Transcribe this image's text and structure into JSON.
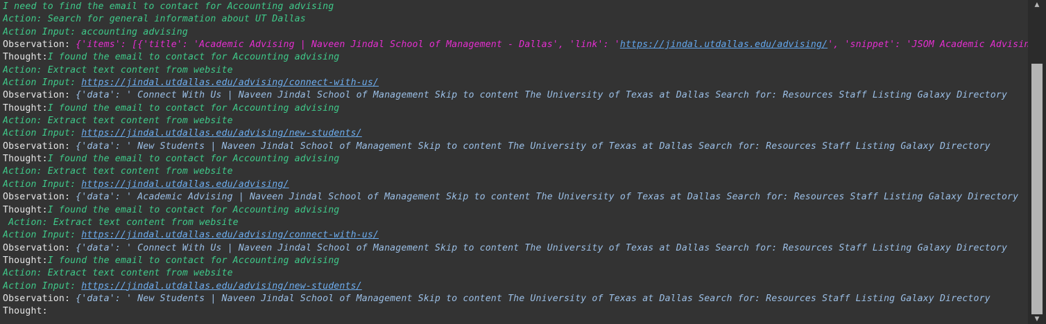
{
  "terminal": {
    "lines": [
      {
        "segments": [
          {
            "text": "I need to find the email to contact for Accounting advising",
            "style": "green"
          }
        ]
      },
      {
        "segments": [
          {
            "text": "Action: Search for general information about UT Dallas",
            "style": "green"
          }
        ]
      },
      {
        "segments": [
          {
            "text": "Action Input: accounting advising",
            "style": "green"
          }
        ]
      },
      {
        "segments": [
          {
            "text": "Observation: ",
            "style": "plain"
          },
          {
            "text": "{'items': [{'title': 'Academic Advising | Naveen Jindal School of Management - Dallas', 'link': '",
            "style": "magenta"
          },
          {
            "text": "https://jindal.utdallas.edu/advising/",
            "style": "link-mag"
          },
          {
            "text": "', 'snippet': 'JSOM Academic Advising",
            "style": "magenta"
          }
        ]
      },
      {
        "segments": [
          {
            "text": "Thought:",
            "style": "plain"
          },
          {
            "text": "I found the email to contact for Accounting advising",
            "style": "green"
          }
        ]
      },
      {
        "segments": [
          {
            "text": "Action: Extract text content from website",
            "style": "green"
          }
        ]
      },
      {
        "segments": [
          {
            "text": "Action Input: ",
            "style": "green"
          },
          {
            "text": "https://jindal.utdallas.edu/advising/connect-with-us/",
            "style": "link"
          }
        ]
      },
      {
        "segments": [
          {
            "text": "Observation: ",
            "style": "plain"
          },
          {
            "text": "{'data': ' Connect With Us | Naveen Jindal School of Management Skip to content The University of Texas at Dallas Search for: Resources Staff Listing Galaxy Directory",
            "style": "blue"
          }
        ]
      },
      {
        "segments": [
          {
            "text": "Thought:",
            "style": "plain"
          },
          {
            "text": "I found the email to contact for Accounting advising",
            "style": "green"
          }
        ]
      },
      {
        "segments": [
          {
            "text": "Action: Extract text content from website",
            "style": "green"
          }
        ]
      },
      {
        "segments": [
          {
            "text": "Action Input: ",
            "style": "green"
          },
          {
            "text": "https://jindal.utdallas.edu/advising/new-students/",
            "style": "link"
          }
        ]
      },
      {
        "segments": [
          {
            "text": "Observation: ",
            "style": "plain"
          },
          {
            "text": "{'data': ' New Students | Naveen Jindal School of Management Skip to content The University of Texas at Dallas Search for: Resources Staff Listing Galaxy Directory",
            "style": "blue"
          }
        ]
      },
      {
        "segments": [
          {
            "text": "Thought:",
            "style": "plain"
          },
          {
            "text": "I found the email to contact for Accounting advising",
            "style": "green"
          }
        ]
      },
      {
        "segments": [
          {
            "text": "Action: Extract text content from website",
            "style": "green"
          }
        ]
      },
      {
        "segments": [
          {
            "text": "Action Input: ",
            "style": "green"
          },
          {
            "text": "https://jindal.utdallas.edu/advising/",
            "style": "link"
          }
        ]
      },
      {
        "segments": [
          {
            "text": "Observation: ",
            "style": "plain"
          },
          {
            "text": "{'data': ' Academic Advising | Naveen Jindal School of Management Skip to content The University of Texas at Dallas Search for: Resources Staff Listing Galaxy Directory",
            "style": "blue"
          }
        ]
      },
      {
        "segments": [
          {
            "text": "Thought:",
            "style": "plain"
          },
          {
            "text": "I found the email to contact for Accounting advising",
            "style": "green"
          }
        ]
      },
      {
        "segments": [
          {
            "text": " Action: Extract text content from website",
            "style": "green"
          }
        ]
      },
      {
        "segments": [
          {
            "text": "Action Input: ",
            "style": "green"
          },
          {
            "text": "https://jindal.utdallas.edu/advising/connect-with-us/",
            "style": "link"
          }
        ]
      },
      {
        "segments": [
          {
            "text": "Observation: ",
            "style": "plain"
          },
          {
            "text": "{'data': ' Connect With Us | Naveen Jindal School of Management Skip to content The University of Texas at Dallas Search for: Resources Staff Listing Galaxy Directory",
            "style": "blue"
          }
        ]
      },
      {
        "segments": [
          {
            "text": "Thought:",
            "style": "plain"
          },
          {
            "text": "I found the email to contact for Accounting advising",
            "style": "green"
          }
        ]
      },
      {
        "segments": [
          {
            "text": "Action: Extract text content from website",
            "style": "green"
          }
        ]
      },
      {
        "segments": [
          {
            "text": "Action Input: ",
            "style": "green"
          },
          {
            "text": "https://jindal.utdallas.edu/advising/new-students/",
            "style": "link"
          }
        ]
      },
      {
        "segments": [
          {
            "text": "Observation: ",
            "style": "plain"
          },
          {
            "text": "{'data': ' New Students | Naveen Jindal School of Management Skip to content The University of Texas at Dallas Search for: Resources Staff Listing Galaxy Directory",
            "style": "blue"
          }
        ]
      },
      {
        "segments": [
          {
            "text": "Thought:",
            "style": "plain"
          }
        ]
      }
    ]
  },
  "scrollbar": {
    "up_icon": "scroll-up-arrow-icon",
    "down_icon": "scroll-down-arrow-icon",
    "position": 0.93
  },
  "colors": {
    "background": "#333333",
    "green": "#3fca8a",
    "magenta": "#e62ed1",
    "blue": "#9bbfe6",
    "link": "#6eaef0",
    "plain": "#e6e6e6"
  }
}
